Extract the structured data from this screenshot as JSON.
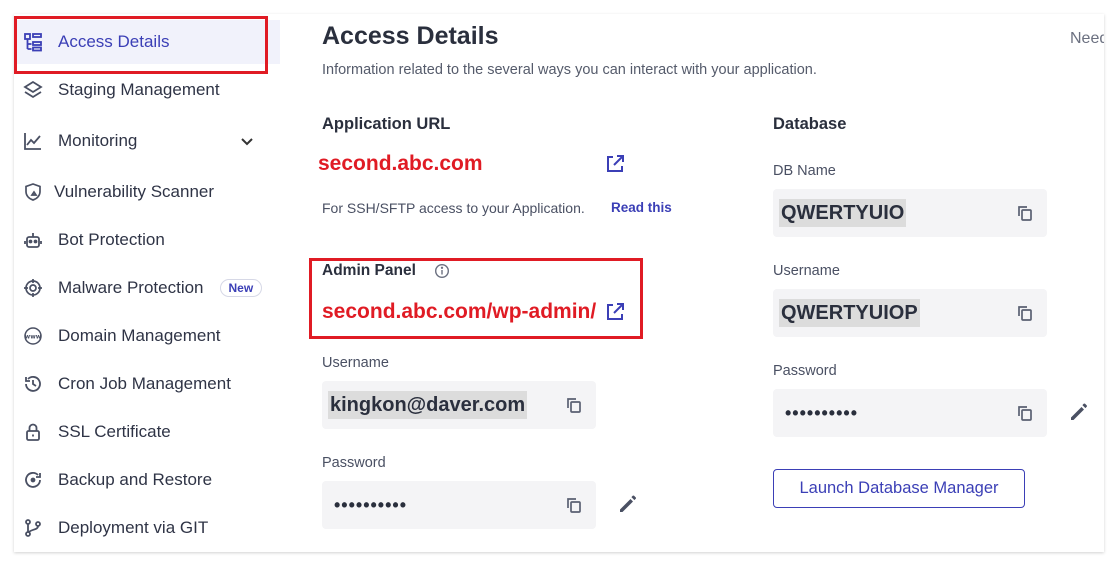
{
  "sidebar": {
    "items": [
      {
        "label": "Access Details",
        "icon": "access-details-icon"
      },
      {
        "label": "Staging Management",
        "icon": "layers-icon"
      },
      {
        "label": "Monitoring",
        "icon": "chart-line-icon"
      },
      {
        "label": "Vulnerability Scanner",
        "icon": "shield-scan-icon"
      },
      {
        "label": "Bot Protection",
        "icon": "robot-icon"
      },
      {
        "label": "Malware Protection",
        "icon": "crosshair-icon",
        "badge": "New"
      },
      {
        "label": "Domain Management",
        "icon": "www-icon"
      },
      {
        "label": "Cron Job Management",
        "icon": "history-icon"
      },
      {
        "label": "SSL Certificate",
        "icon": "lock-icon"
      },
      {
        "label": "Backup and Restore",
        "icon": "backup-icon"
      },
      {
        "label": "Deployment via GIT",
        "icon": "git-branch-icon"
      }
    ]
  },
  "header": {
    "title": "Access Details",
    "subtitle": "Information related to the several ways you can interact with your application.",
    "help_text": "Need"
  },
  "application": {
    "heading": "Application URL",
    "url": "second.abc.com",
    "ssh_note": "For SSH/SFTP access to your Application.",
    "read_this": "Read this"
  },
  "admin": {
    "heading": "Admin Panel",
    "url": "second.abc.com/wp-admin/",
    "username_label": "Username",
    "username": "kingkon@daver.com",
    "password_label": "Password",
    "password": "••••••••••"
  },
  "database": {
    "heading": "Database",
    "db_name_label": "DB Name",
    "db_name": "QWERTYUIO",
    "username_label": "Username",
    "username": "QWERTYUIOP",
    "password_label": "Password",
    "password": "••••••••••",
    "launch_label": "Launch Database Manager"
  },
  "colors": {
    "accent": "#3b3fb6",
    "highlight": "#e01b24"
  }
}
